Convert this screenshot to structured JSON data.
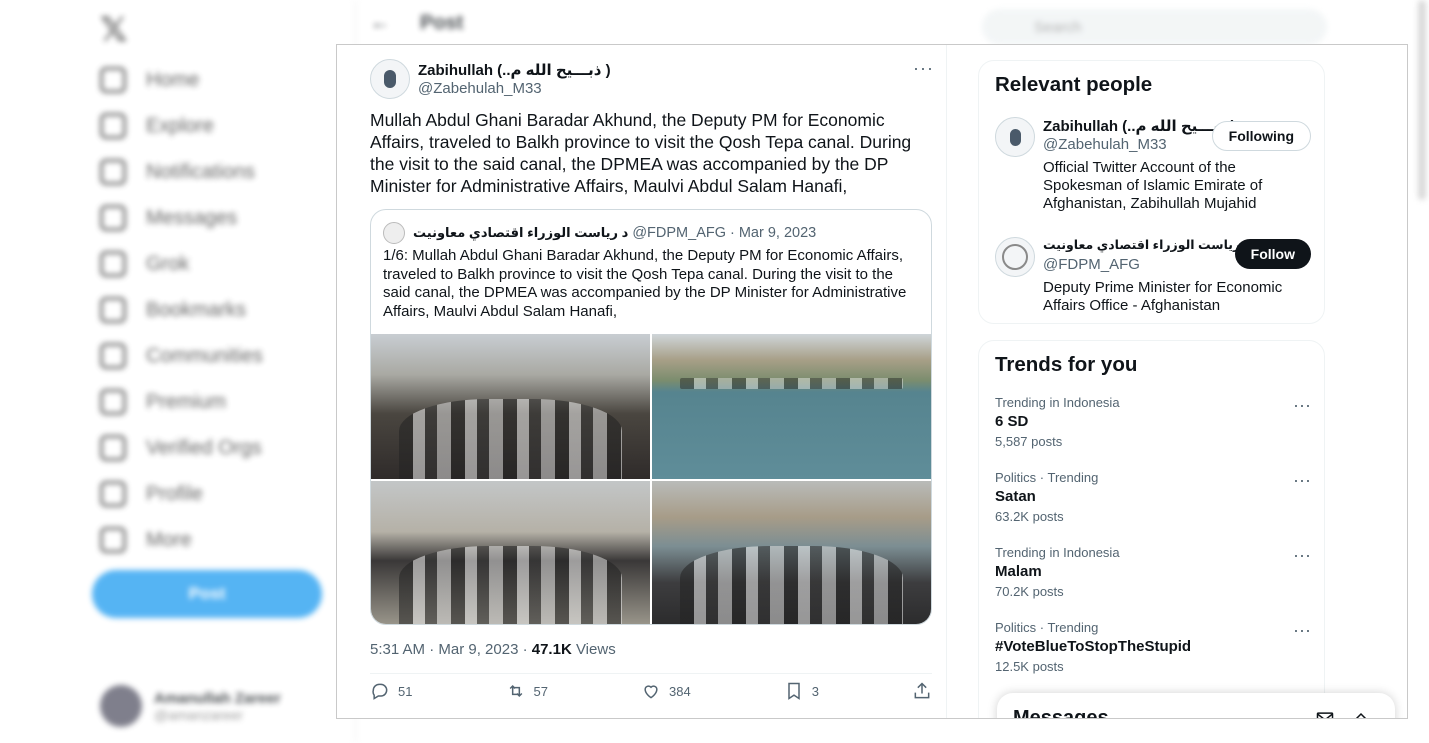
{
  "background": {
    "nav": [
      "Home",
      "Explore",
      "Notifications",
      "Messages",
      "Grok",
      "Bookmarks",
      "Communities",
      "Premium",
      "Verified Orgs",
      "Profile",
      "More"
    ],
    "post_button": "Post",
    "header_title": "Post",
    "search_placeholder": "Search",
    "user_name": "Amanullah Zareer",
    "user_handle": "@amanzareer"
  },
  "tweet": {
    "author_name": "Zabihullah (..ذبـــیح الله م )",
    "author_handle": "@Zabehulah_M33",
    "text": "Mullah Abdul Ghani Baradar Akhund, the Deputy PM for Economic Affairs, traveled to Balkh province to visit the Qosh Tepa canal. During the visit to the said canal, the DPMEA was accompanied by the DP Minister for Administrative Affairs, Maulvi Abdul Salam Hanafi,",
    "quote": {
      "author_name": "د ریاست الوزراء اقتصادي معاونیت",
      "author_handle": "@FDPM_AFG",
      "date": "Mar 9, 2023",
      "text": "1/6: Mullah Abdul Ghani Baradar Akhund, the Deputy PM for Economic Affairs, traveled to Balkh province to visit the Qosh Tepa canal. During the visit to the said canal, the DPMEA was accompanied by the DP Minister for Administrative Affairs, Maulvi Abdul Salam Hanafi,"
    },
    "timestamp": "5:31 AM · Mar 9, 2023 · ",
    "views_count": "47.1K",
    "views_label": "Views",
    "replies": "51",
    "reposts": "57",
    "likes": "384",
    "bookmarks": "3"
  },
  "relevant_people": {
    "title": "Relevant people",
    "people": [
      {
        "name": "Zabihullah (..ذبـــیح الله م )",
        "handle": "@Zabehulah_M33",
        "bio": "Official Twitter Account of the Spokesman of Islamic Emirate of Afghanistan, Zabihullah Mujahid",
        "button": "Following"
      },
      {
        "name": "د ریاست الوزراء اقتصادي معاونیت",
        "handle": "@FDPM_AFG",
        "bio": "Deputy Prime Minister for Economic Affairs Office - Afghanistan",
        "button": "Follow"
      }
    ]
  },
  "trends": {
    "title": "Trends for you",
    "items": [
      {
        "context": "Trending in Indonesia",
        "name": "6 SD",
        "count": "5,587 posts"
      },
      {
        "context": "Politics · Trending",
        "name": "Satan",
        "count": "63.2K posts"
      },
      {
        "context": "Trending in Indonesia",
        "name": "Malam",
        "count": "70.2K posts"
      },
      {
        "context": "Politics · Trending",
        "name": "#VoteBlueToStopTheStupid",
        "count": "12.5K posts"
      }
    ]
  },
  "messages_drawer": {
    "title": "Messages"
  },
  "colors": {
    "accent": "#1d9bf0",
    "text": "#0f1419",
    "muted": "#536471",
    "border": "#cfd9de"
  }
}
